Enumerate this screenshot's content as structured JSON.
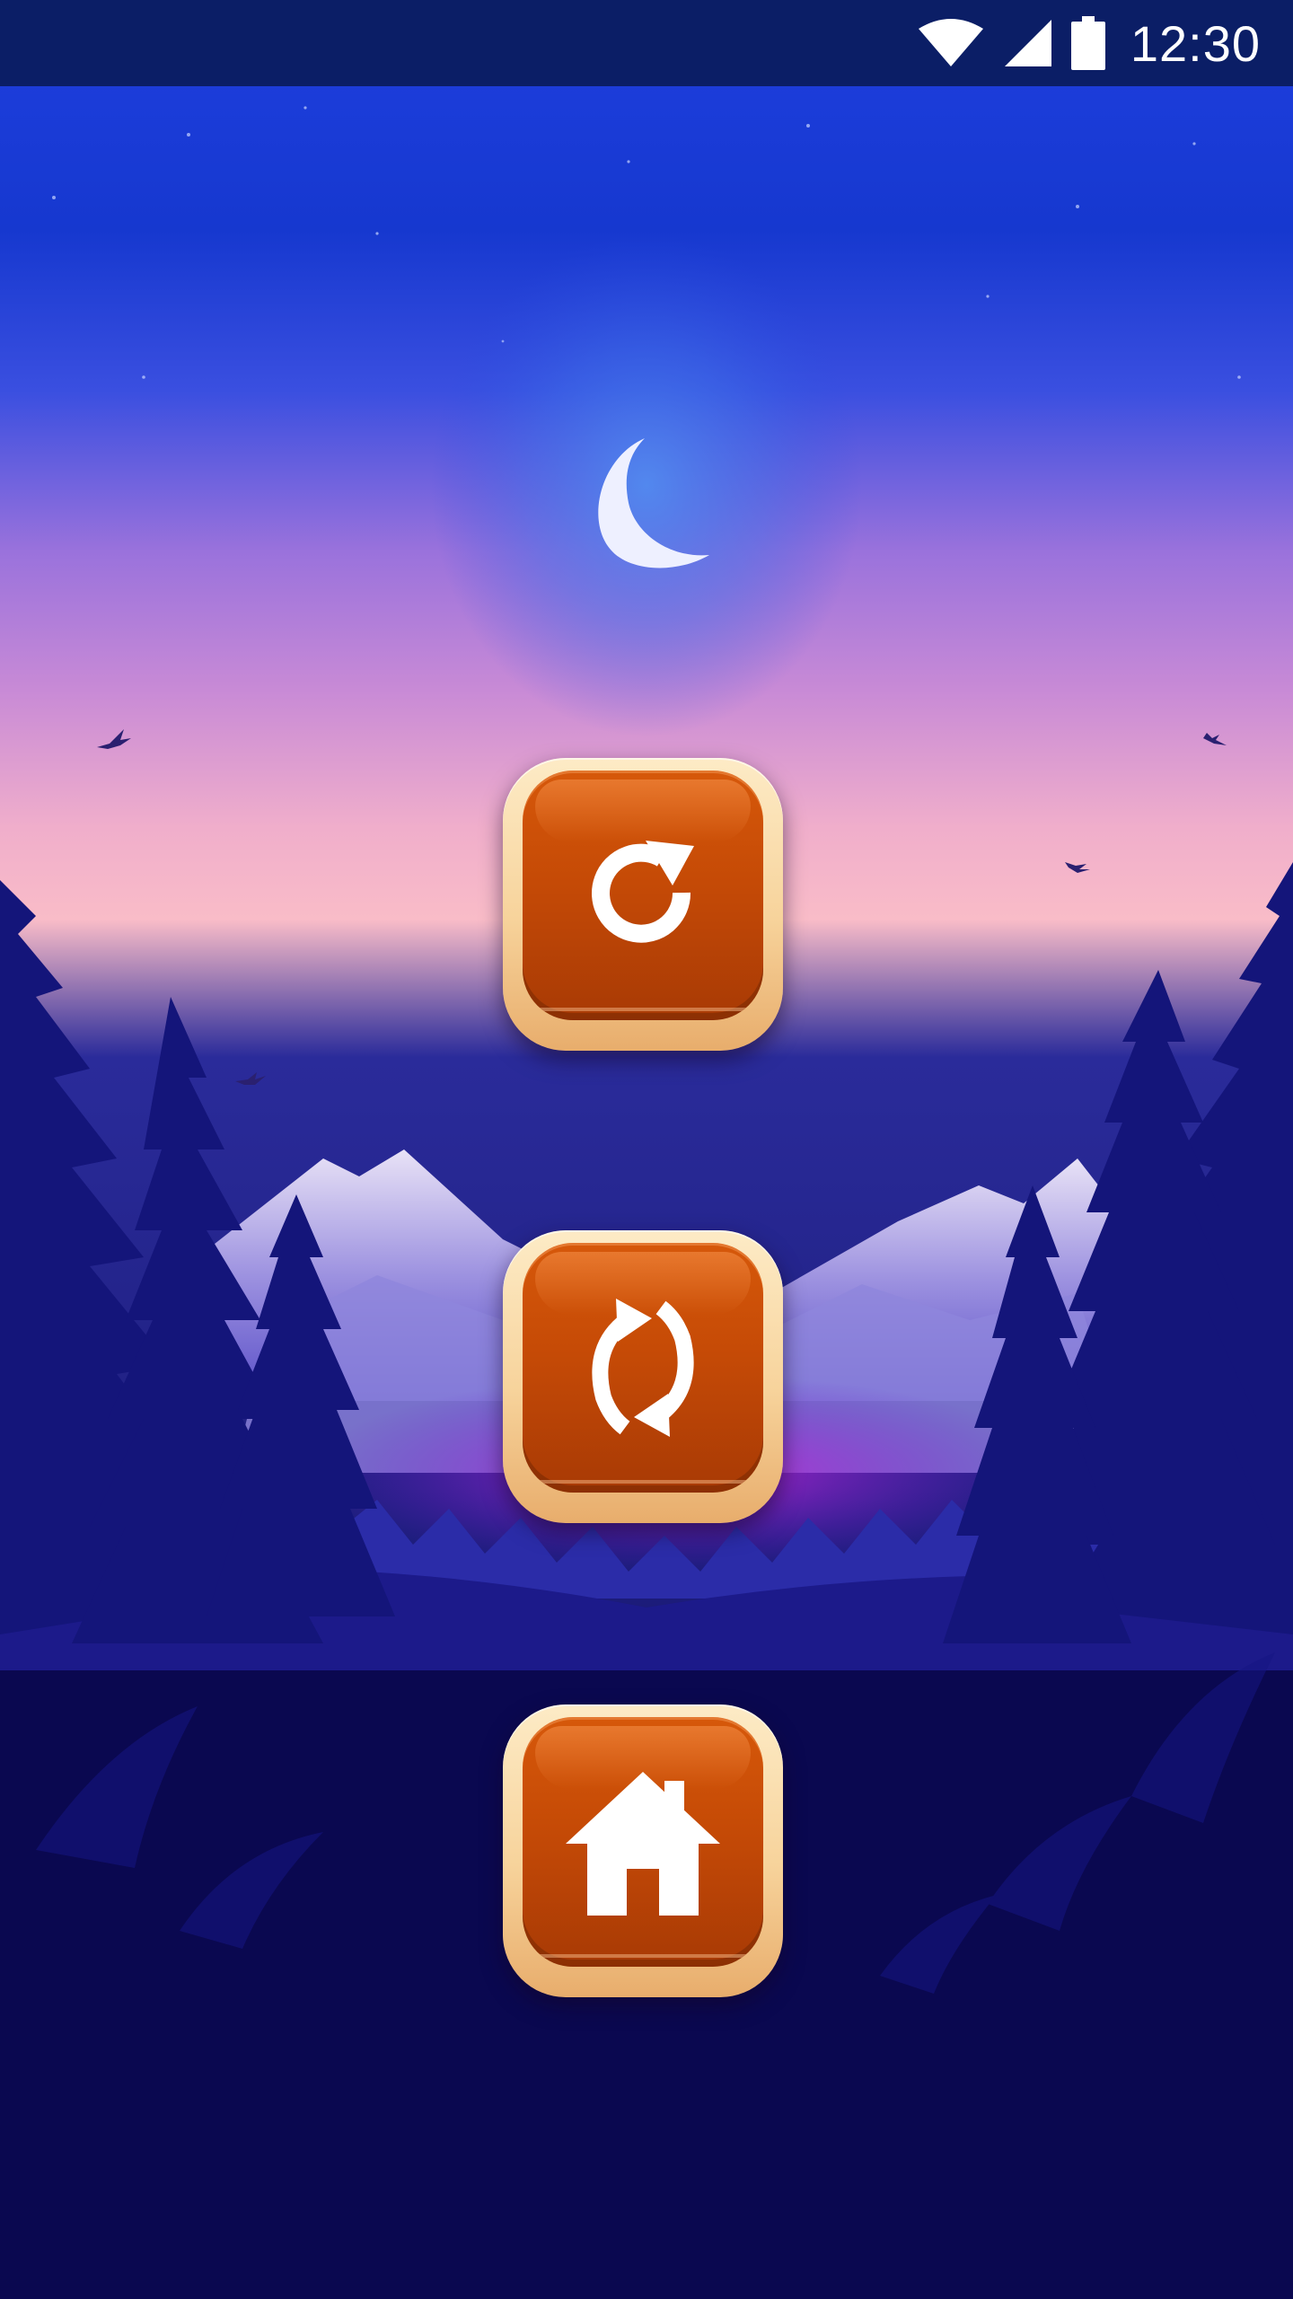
{
  "status_bar": {
    "time": "12:30",
    "icons": [
      "wifi-icon",
      "cell-signal-icon",
      "battery-icon"
    ]
  },
  "scene": {
    "description_icons": [
      "moon-icon",
      "bird-icon",
      "pine-tree-icon",
      "mountain-icon"
    ]
  },
  "buttons": [
    {
      "id": "restart",
      "icon": "restart-icon"
    },
    {
      "id": "swap",
      "icon": "refresh-icon"
    },
    {
      "id": "home",
      "icon": "home-icon"
    }
  ],
  "colors": {
    "status_bar": "#0b1e66",
    "sky_top": "#1a3ad8",
    "sky_mid": "#a87ad8",
    "horizon": "#f4b3c8",
    "ground": "#0a0850",
    "button_face": "#c54a06",
    "button_frame": "#f7d39b"
  }
}
